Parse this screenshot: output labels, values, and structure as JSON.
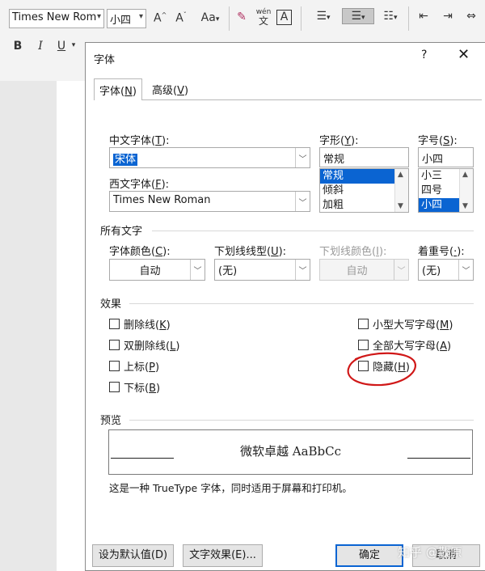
{
  "ribbon": {
    "font_name": "Times New Rom",
    "font_size": "小四",
    "row1_buttons": [
      "A",
      "A",
      "Aa",
      "wén",
      "A"
    ],
    "row2_buttons": [
      "B",
      "I",
      "U"
    ]
  },
  "dialog": {
    "title": "字体",
    "help": "?",
    "close": "✕",
    "tabs": [
      {
        "label": "字体",
        "key": "N"
      },
      {
        "label": "高级",
        "key": "V"
      }
    ],
    "chinese_font": {
      "label": "中文字体",
      "key": "T",
      "value": "宋体"
    },
    "western_font": {
      "label": "西文字体",
      "key": "F",
      "value": "Times New Roman"
    },
    "style": {
      "label": "字形",
      "key": "Y",
      "value": "常规",
      "options": [
        "常规",
        "倾斜",
        "加粗"
      ],
      "selected": 0
    },
    "size": {
      "label": "字号",
      "key": "S",
      "value": "小四",
      "options": [
        "小三",
        "四号",
        "小四"
      ],
      "selected": 2
    },
    "all_text": {
      "heading": "所有文字",
      "font_color": {
        "label": "字体颜色",
        "key": "C",
        "value": "自动"
      },
      "underline_style": {
        "label": "下划线线型",
        "key": "U",
        "value": "(无)"
      },
      "underline_color": {
        "label": "下划线颜色",
        "key": "I",
        "value": "自动"
      },
      "emphasis": {
        "label": "着重号",
        "key": "·",
        "value": "(无)"
      }
    },
    "effects": {
      "heading": "效果",
      "left": [
        {
          "label": "删除线",
          "key": "K",
          "checked": false
        },
        {
          "label": "双删除线",
          "key": "L",
          "checked": false
        },
        {
          "label": "上标",
          "key": "P",
          "checked": false
        },
        {
          "label": "下标",
          "key": "B",
          "checked": false
        }
      ],
      "right": [
        {
          "label": "小型大写字母",
          "key": "M",
          "checked": false
        },
        {
          "label": "全部大写字母",
          "key": "A",
          "checked": false
        },
        {
          "label": "隐藏",
          "key": "H",
          "checked": false
        }
      ]
    },
    "preview": {
      "heading": "预览",
      "sample": "微软卓越  AaBbCc",
      "note": "这是一种 TrueType 字体，同时适用于屏幕和打印机。"
    },
    "buttons": {
      "set_default": "设为默认值(D)",
      "text_effects": "文字效果(E)...",
      "ok": "确定",
      "cancel": "取消"
    }
  },
  "watermark": "知乎 @散原",
  "colors": {
    "accent": "#0a64d2",
    "annotation": "#d01818"
  }
}
